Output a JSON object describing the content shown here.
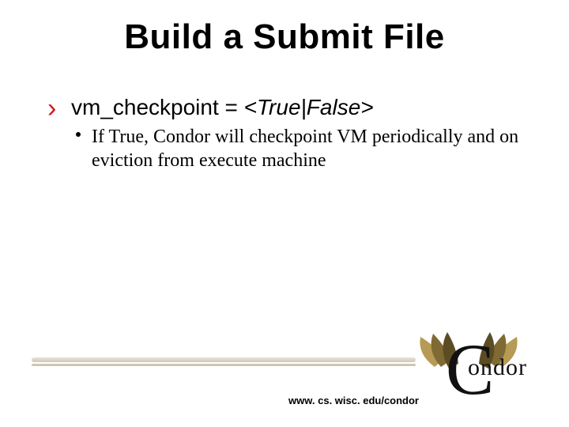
{
  "title": "Build a Submit File",
  "bullet1": {
    "key": "vm_checkpoint = ",
    "value": "<True|False>"
  },
  "sub1_lead": "If True, ",
  "sub1_rest": "Condor will checkpoint VM periodically and on eviction from execute machine",
  "url": "www. cs. wisc. edu/condor",
  "logo": {
    "big_letter": "C",
    "rest": "ondor"
  }
}
